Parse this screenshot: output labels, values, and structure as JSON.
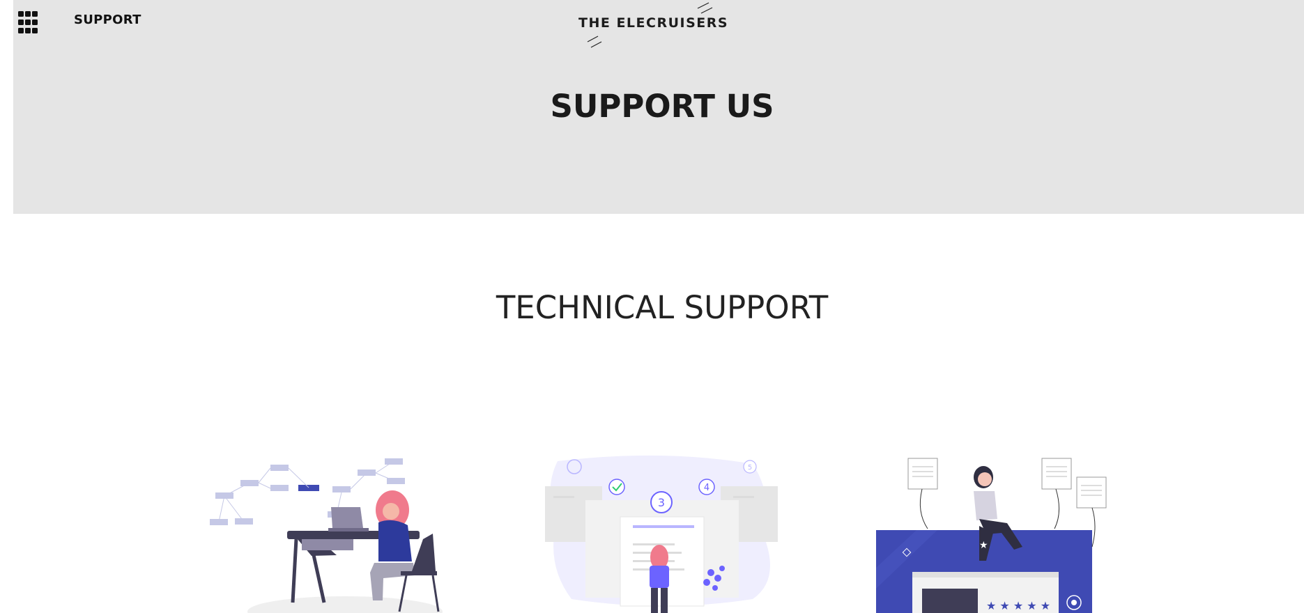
{
  "header": {
    "menu_icon": "grid-icon",
    "nav_label": "SUPPORT",
    "logo_text": "THE ELECRUISERS"
  },
  "hero": {
    "title": "SUPPORT US"
  },
  "section": {
    "title": "TECHNICAL SUPPORT"
  },
  "illustrations": [
    {
      "name": "woman-at-desk-illustration"
    },
    {
      "name": "checklist-steps-illustration",
      "step_badges": [
        "3",
        "4",
        "5"
      ]
    },
    {
      "name": "woman-sitting-on-rating-board-illustration"
    }
  ],
  "colors": {
    "hero_bg": "#e5e5e5",
    "accent_indigo": "#3f4ab3",
    "accent_pink": "#f07a8c",
    "accent_purple": "#6c63ff"
  }
}
